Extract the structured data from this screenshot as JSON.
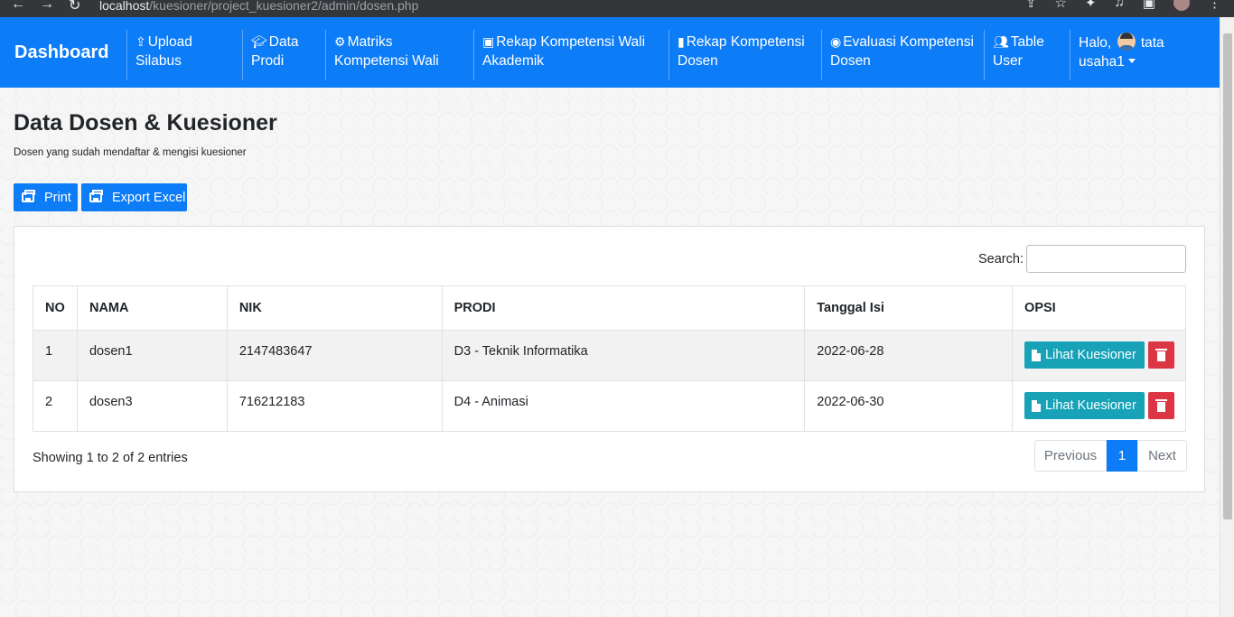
{
  "browser": {
    "url_host": "localhost",
    "url_path": "/kuesioner/project_kuesioner2/admin/dosen.php"
  },
  "navbar": {
    "brand": "Dashboard",
    "items": [
      {
        "icon": "upload-icon",
        "label": "Upload Silabus"
      },
      {
        "icon": "graduation-cap-icon",
        "label": "Data Prodi"
      },
      {
        "icon": "gear-icon",
        "label": "Matriks Kompetensi Wali"
      },
      {
        "icon": "id-badge-icon",
        "label": "Rekap Kompetensi Wali Akademik"
      },
      {
        "icon": "file-icon",
        "label": "Rekap Kompetensi Dosen"
      },
      {
        "icon": "user-circle-icon",
        "label": "Evaluasi Kompetensi Dosen"
      },
      {
        "icon": "users-icon",
        "label": "Table User"
      }
    ],
    "user": {
      "greeting": "Halo,",
      "name_line1": "tata",
      "name_line2": "usaha1"
    }
  },
  "page": {
    "title": "Data Dosen & Kuesioner",
    "subtitle": "Dosen yang sudah mendaftar & mengisi kuesioner",
    "print_label": "Print",
    "export_label": "Export Excel"
  },
  "search": {
    "label": "Search:",
    "placeholder": ""
  },
  "table": {
    "headers": [
      "NO",
      "NAMA",
      "NIK",
      "PRODI",
      "Tanggal Isi",
      "OPSI"
    ],
    "rows": [
      {
        "no": "1",
        "nama": "dosen1",
        "nik": "2147483647",
        "prodi": "D3 - Teknik Informatika",
        "tanggal": "2022-06-28"
      },
      {
        "no": "2",
        "nama": "dosen3",
        "nik": "716212183",
        "prodi": "D4 - Animasi",
        "tanggal": "2022-06-30"
      }
    ],
    "view_label": "Lihat Kuesioner"
  },
  "footer": {
    "info": "Showing 1 to 2 of 2 entries",
    "prev": "Previous",
    "page": "1",
    "next": "Next"
  },
  "colors": {
    "primary": "#0d7cf7",
    "info": "#17a2b8",
    "danger": "#dc3545"
  }
}
